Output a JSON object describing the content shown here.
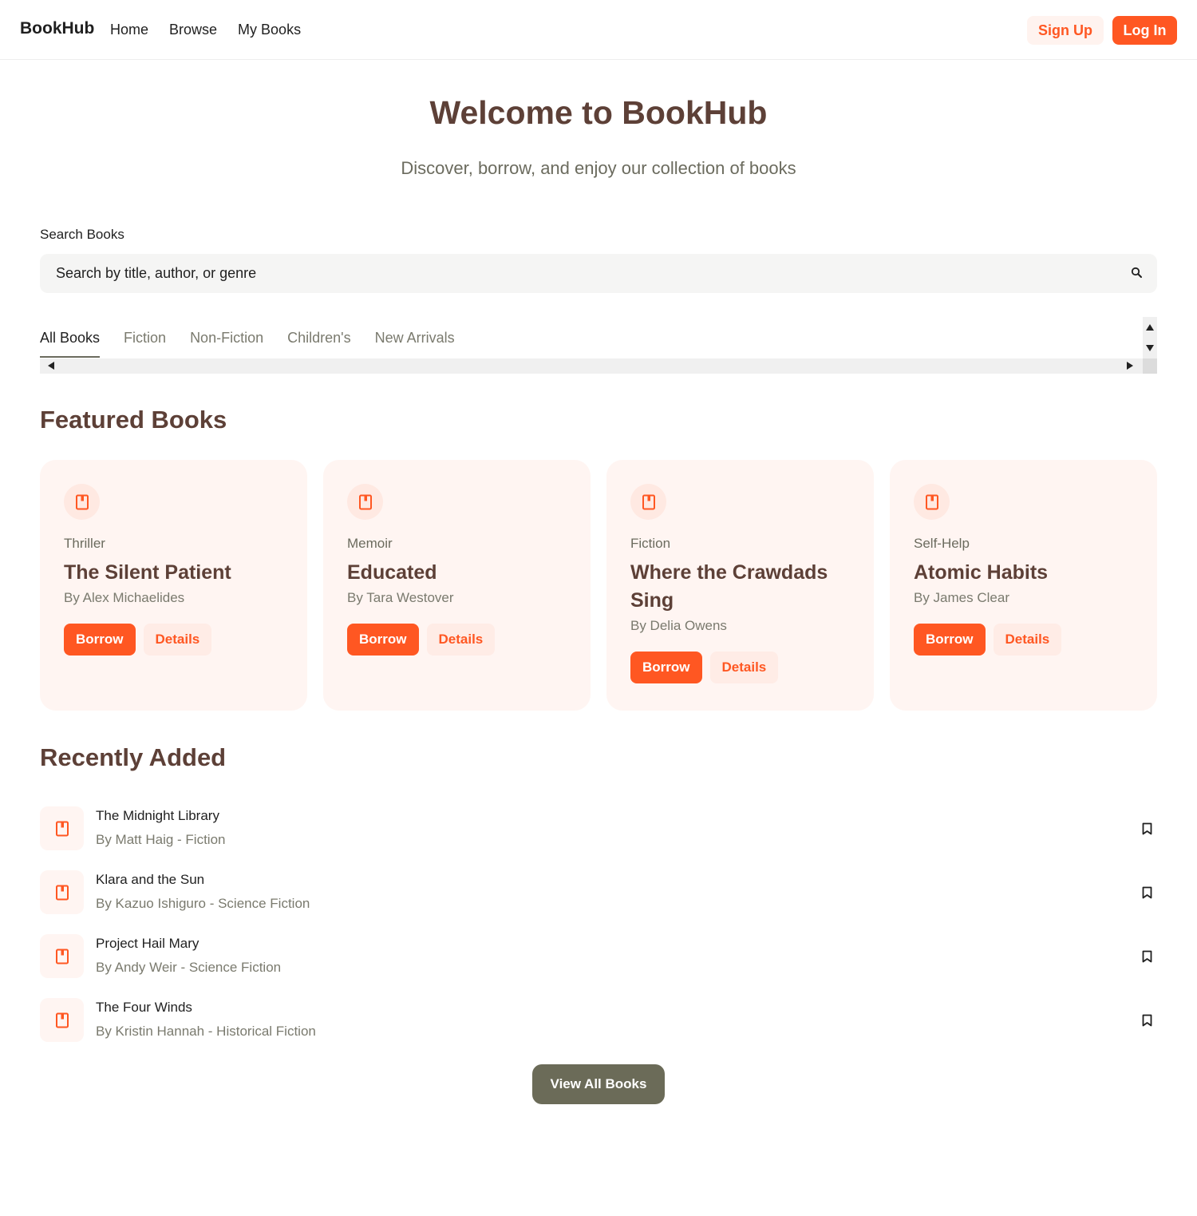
{
  "header": {
    "brand": "BookHub",
    "nav": [
      "Home",
      "Browse",
      "My Books"
    ],
    "signup_label": "Sign Up",
    "login_label": "Log In"
  },
  "hero": {
    "title": "Welcome to BookHub",
    "subtitle": "Discover, borrow, and enjoy our collection of books"
  },
  "search": {
    "label": "Search Books",
    "placeholder": "Search by title, author, or genre",
    "icon": "search-icon"
  },
  "tabs": {
    "items": [
      "All Books",
      "Fiction",
      "Non-Fiction",
      "Children's",
      "New Arrivals"
    ],
    "active": "All Books"
  },
  "featured": {
    "title": "Featured Books",
    "books": [
      {
        "genre": "Thriller",
        "title": "The Silent Patient",
        "author": "By Alex Michaelides",
        "borrow_label": "Borrow",
        "details_label": "Details"
      },
      {
        "genre": "Memoir",
        "title": "Educated",
        "author": "By Tara Westover",
        "borrow_label": "Borrow",
        "details_label": "Details"
      },
      {
        "genre": "Fiction",
        "title": "Where the Crawdads Sing",
        "author": "By Delia Owens",
        "borrow_label": "Borrow",
        "details_label": "Details"
      },
      {
        "genre": "Self-Help",
        "title": "Atomic Habits",
        "author": "By James Clear",
        "borrow_label": "Borrow",
        "details_label": "Details"
      }
    ]
  },
  "recent": {
    "title": "Recently Added",
    "items": [
      {
        "title": "The Midnight Library",
        "meta": "By Matt Haig - Fiction"
      },
      {
        "title": "Klara and the Sun",
        "meta": "By Kazuo Ishiguro - Science Fiction"
      },
      {
        "title": "Project Hail Mary",
        "meta": "By Andy Weir - Science Fiction"
      },
      {
        "title": "The Four Winds",
        "meta": "By Kristin Hannah - Historical Fiction"
      }
    ],
    "view_all_label": "View All Books"
  },
  "colors": {
    "accent": "#ff5722",
    "heading": "#5d4037",
    "card_bg": "#fff5f2",
    "view_all_bg": "#6b6b58"
  }
}
